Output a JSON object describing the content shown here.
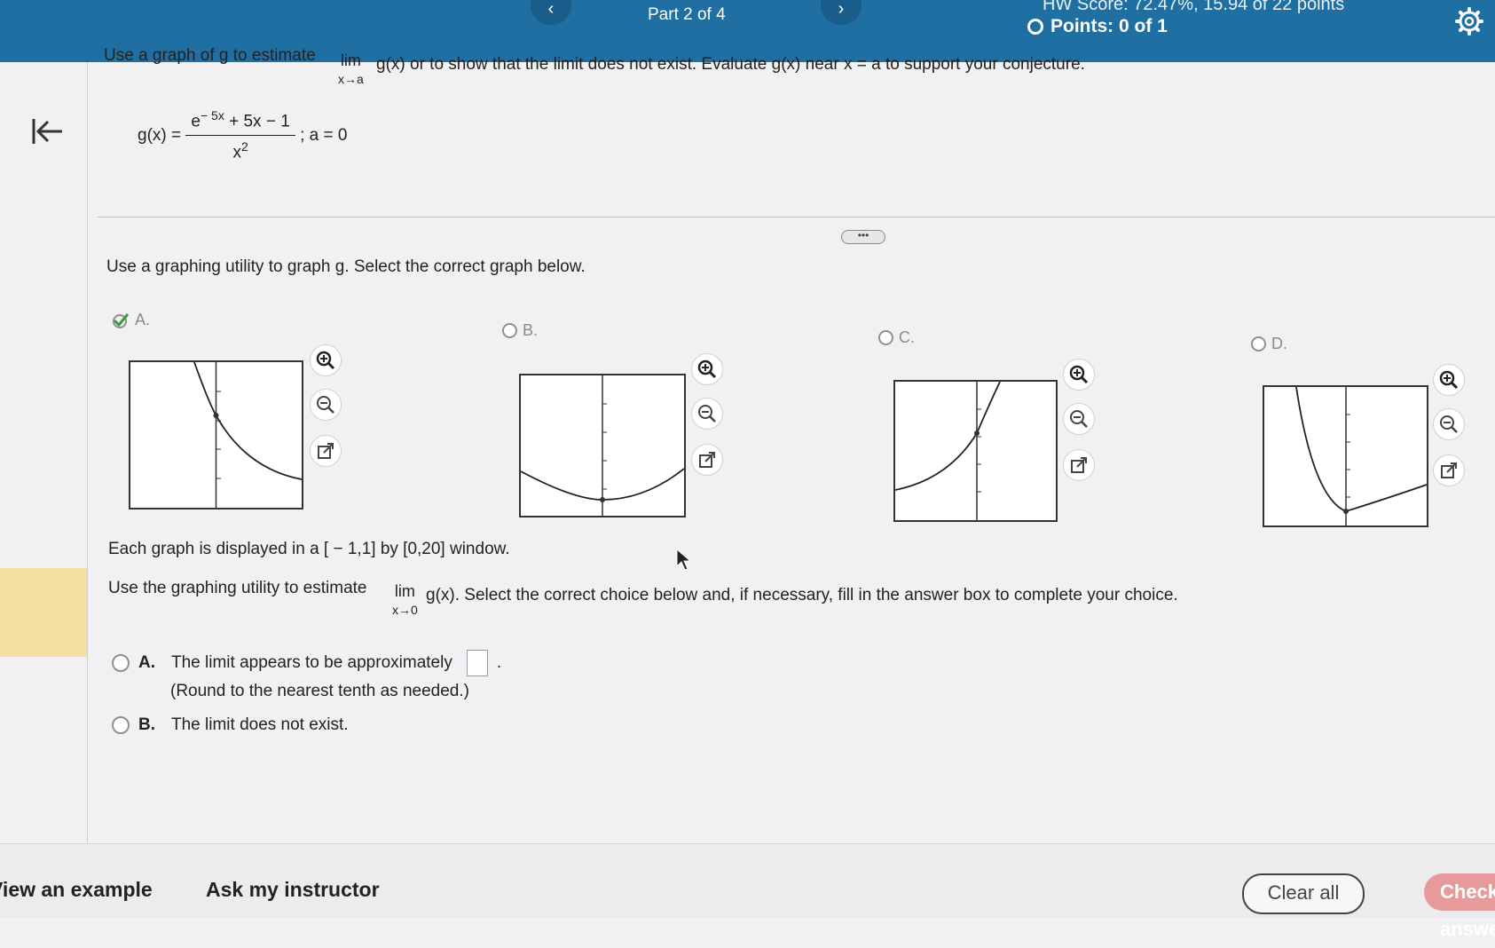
{
  "header": {
    "part": "Part 2 of 4",
    "score": "HW Score: 72.47%, 15.94 of 22 points",
    "points": "Points: 0 of 1"
  },
  "question": {
    "intro_before_lim": "Use a graph of g to estimate",
    "lim_word": "lim",
    "lim_sub": "x→a",
    "intro_after_lim": "g(x) or to show that the limit does not exist. Evaluate g(x) near x = a to support your conjecture.",
    "formula_lhs": "g(x) =",
    "formula_num": "e",
    "formula_exp": "− 5x",
    "formula_num_rest": " + 5x − 1",
    "formula_den": "x",
    "formula_den_exp": "2",
    "formula_tail": "; a = 0"
  },
  "instruction": "Use a graphing utility to graph g. Select the correct graph below.",
  "graph_options": [
    {
      "label": "A.",
      "selected": true
    },
    {
      "label": "B.",
      "selected": false
    },
    {
      "label": "C.",
      "selected": false
    },
    {
      "label": "D.",
      "selected": false
    }
  ],
  "window_note": "Each graph is displayed in a [ − 1,1] by [0,20] window.",
  "estimate_before_lim": "Use the graphing utility to estimate",
  "estimate_lim_word": "lim",
  "estimate_lim_sub": "x→0",
  "estimate_after_lim": "g(x). Select the correct choice below and, if necessary, fill in the answer box to complete your choice.",
  "choices": {
    "a_letter": "A.",
    "a_text": "The limit appears to be approximately",
    "a_period": ".",
    "a_hint": "(Round to the nearest tenth as needed.)",
    "b_letter": "B.",
    "b_text": "The limit does not exist."
  },
  "footer": {
    "view_example": "View an example",
    "ask_instructor": "Ask my instructor",
    "clear_all": "Clear all",
    "check_answer": "Check answer"
  },
  "colors": {
    "header_bg": "#1f6fa3",
    "selected_green": "#3a9b3a",
    "check_button": "#e79a9a"
  }
}
